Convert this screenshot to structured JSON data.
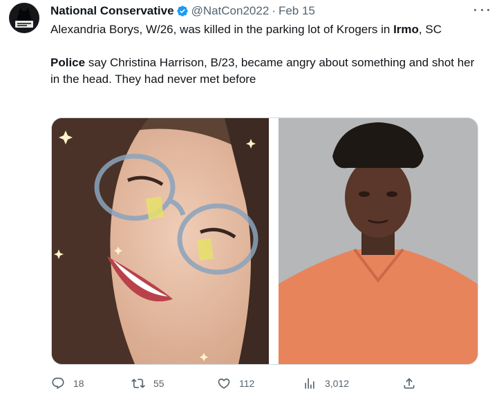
{
  "author": {
    "name": "National Conservative",
    "handle": "@NatCon2022",
    "separator": "·",
    "date": "Feb 15"
  },
  "text": {
    "p1_a": "Alexandria Borys, W/26, was killed in the parking lot of Krogers in ",
    "p1_bold": "Irmo",
    "p1_b": ", SC",
    "p2_bold": "Police",
    "p2_a": " say Christina Harrison, B/23, became angry about something and shot her in the head. They had never met before"
  },
  "actions": {
    "replies": "18",
    "retweets": "55",
    "likes": "112",
    "views": "3,012"
  },
  "icons": [
    "verified-badge-icon",
    "more-icon",
    "reply-icon",
    "retweet-icon",
    "like-icon",
    "views-icon",
    "share-icon"
  ],
  "colors": {
    "verified": "#1d9bf0",
    "muted": "#536471",
    "text": "#0f1419",
    "border": "#cfd9de",
    "jumpsuit": "#e8845c"
  }
}
